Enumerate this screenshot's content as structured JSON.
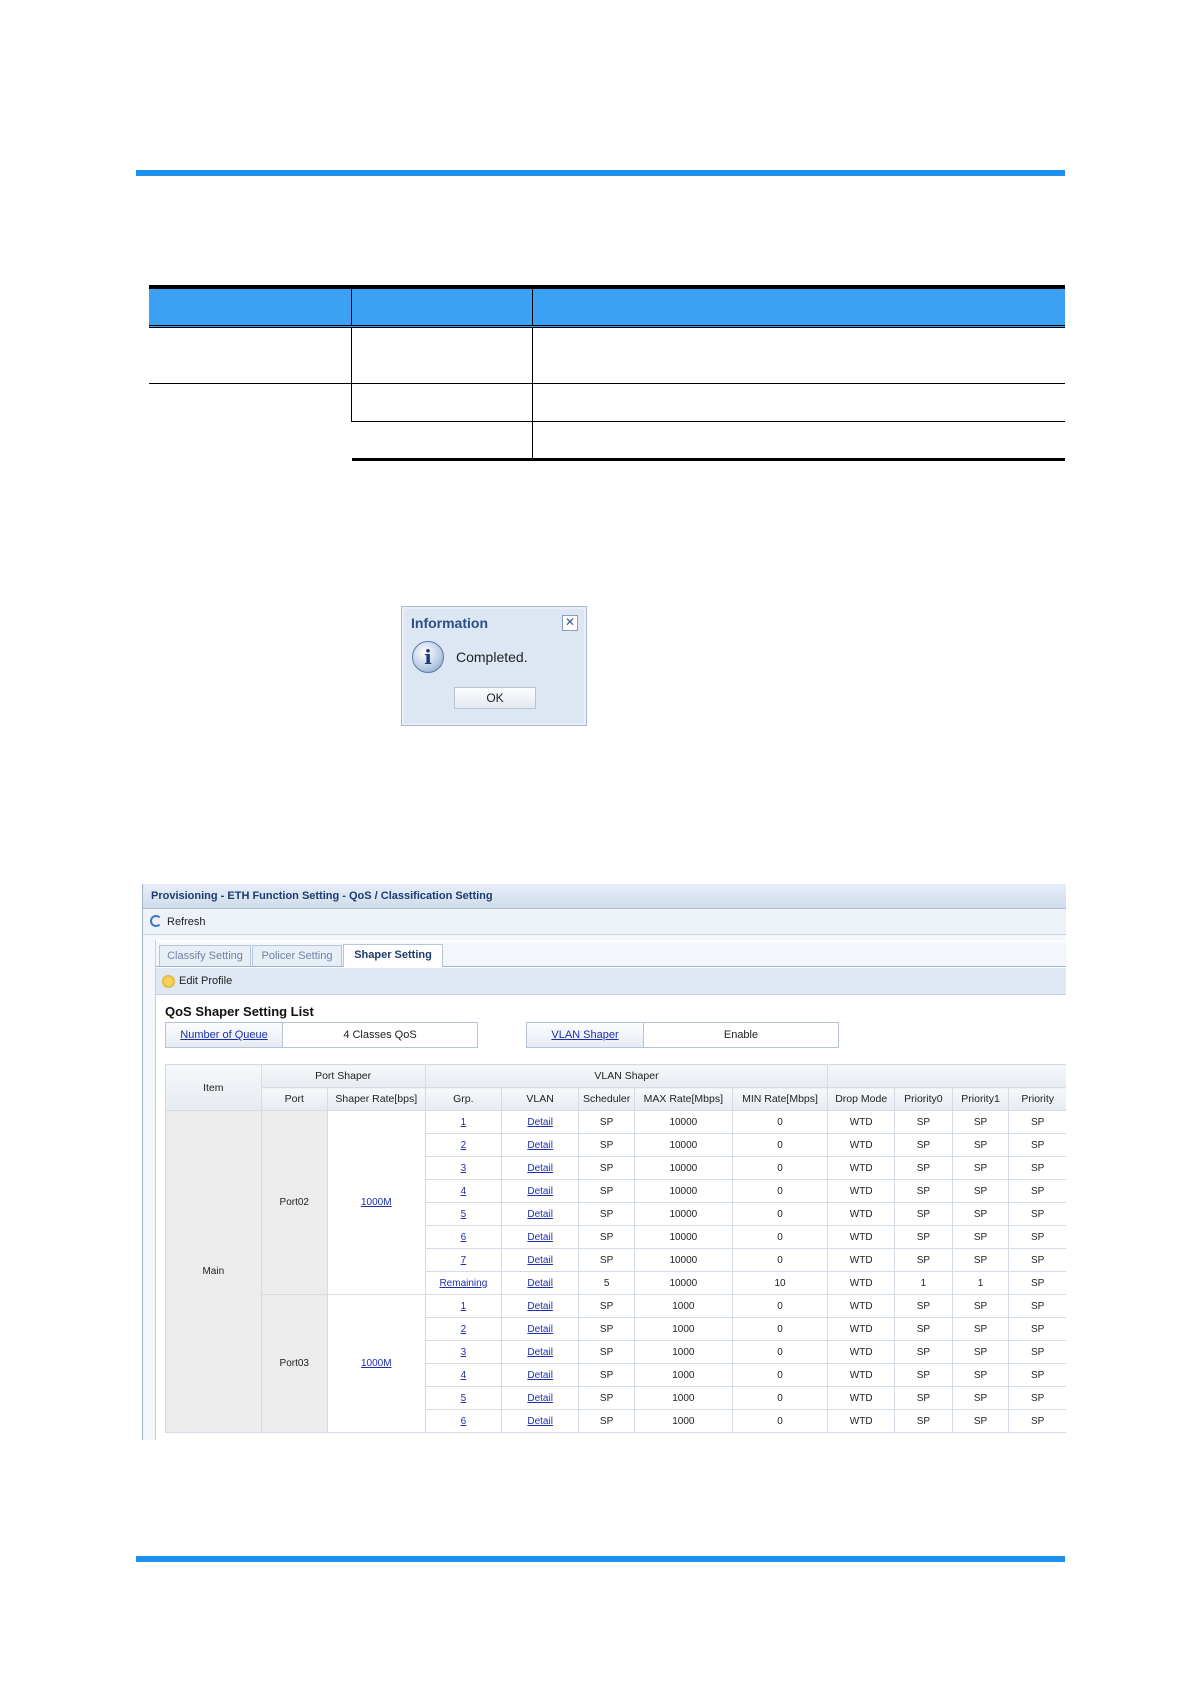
{
  "colors": {
    "rule": "#1e90ee",
    "table_header": "#3aa1f5",
    "link": "#1c2fb0",
    "app_title": "#1c3c6e"
  },
  "dialog": {
    "title": "Information",
    "message": "Completed.",
    "ok_label": "OK",
    "close_glyph": "✕",
    "info_glyph": "i"
  },
  "app": {
    "title": "Provisioning - ETH Function Setting - QoS / Classification Setting",
    "refresh_label": "Refresh",
    "tabs": [
      {
        "label": "Classify Setting"
      },
      {
        "label": "Policer Setting"
      },
      {
        "label": "Shaper Setting"
      }
    ],
    "edit_profile_label": "Edit Profile",
    "list_title": "QoS Shaper Setting List",
    "number_of_queue": {
      "label": "Number of Queue",
      "value": "4 Classes QoS"
    },
    "vlan_shaper": {
      "label": "VLAN Shaper",
      "value": "Enable"
    },
    "table": {
      "group_headers": {
        "item": "Item",
        "port_shaper": "Port Shaper",
        "vlan_shaper": "VLAN Shaper"
      },
      "headers": {
        "port": "Port",
        "shaper_rate": "Shaper Rate[bps]",
        "grp": "Grp.",
        "vlan": "VLAN",
        "scheduler": "Scheduler",
        "max_rate": "MAX Rate[Mbps]",
        "min_rate": "MIN Rate[Mbps]",
        "drop_mode": "Drop Mode",
        "priority0": "Priority0",
        "priority1": "Priority1",
        "priority2": "Priority"
      },
      "item": "Main",
      "ports": [
        {
          "port": "Port02",
          "rate": "1000M",
          "rows": [
            {
              "grp": "1",
              "vlan": "Detail",
              "scheduler": "SP",
              "max": "10000",
              "min": "0",
              "drop": "WTD",
              "p0": "SP",
              "p1": "SP",
              "p2": "SP"
            },
            {
              "grp": "2",
              "vlan": "Detail",
              "scheduler": "SP",
              "max": "10000",
              "min": "0",
              "drop": "WTD",
              "p0": "SP",
              "p1": "SP",
              "p2": "SP"
            },
            {
              "grp": "3",
              "vlan": "Detail",
              "scheduler": "SP",
              "max": "10000",
              "min": "0",
              "drop": "WTD",
              "p0": "SP",
              "p1": "SP",
              "p2": "SP"
            },
            {
              "grp": "4",
              "vlan": "Detail",
              "scheduler": "SP",
              "max": "10000",
              "min": "0",
              "drop": "WTD",
              "p0": "SP",
              "p1": "SP",
              "p2": "SP"
            },
            {
              "grp": "5",
              "vlan": "Detail",
              "scheduler": "SP",
              "max": "10000",
              "min": "0",
              "drop": "WTD",
              "p0": "SP",
              "p1": "SP",
              "p2": "SP"
            },
            {
              "grp": "6",
              "vlan": "Detail",
              "scheduler": "SP",
              "max": "10000",
              "min": "0",
              "drop": "WTD",
              "p0": "SP",
              "p1": "SP",
              "p2": "SP"
            },
            {
              "grp": "7",
              "vlan": "Detail",
              "scheduler": "SP",
              "max": "10000",
              "min": "0",
              "drop": "WTD",
              "p0": "SP",
              "p1": "SP",
              "p2": "SP"
            },
            {
              "grp": "Remaining",
              "vlan": "Detail",
              "scheduler": "5",
              "max": "10000",
              "min": "10",
              "drop": "WTD",
              "p0": "1",
              "p1": "1",
              "p2": "SP"
            }
          ]
        },
        {
          "port": "Port03",
          "rate": "1000M",
          "rows": [
            {
              "grp": "1",
              "vlan": "Detail",
              "scheduler": "SP",
              "max": "1000",
              "min": "0",
              "drop": "WTD",
              "p0": "SP",
              "p1": "SP",
              "p2": "SP"
            },
            {
              "grp": "2",
              "vlan": "Detail",
              "scheduler": "SP",
              "max": "1000",
              "min": "0",
              "drop": "WTD",
              "p0": "SP",
              "p1": "SP",
              "p2": "SP"
            },
            {
              "grp": "3",
              "vlan": "Detail",
              "scheduler": "SP",
              "max": "1000",
              "min": "0",
              "drop": "WTD",
              "p0": "SP",
              "p1": "SP",
              "p2": "SP"
            },
            {
              "grp": "4",
              "vlan": "Detail",
              "scheduler": "SP",
              "max": "1000",
              "min": "0",
              "drop": "WTD",
              "p0": "SP",
              "p1": "SP",
              "p2": "SP"
            },
            {
              "grp": "5",
              "vlan": "Detail",
              "scheduler": "SP",
              "max": "1000",
              "min": "0",
              "drop": "WTD",
              "p0": "SP",
              "p1": "SP",
              "p2": "SP"
            },
            {
              "grp": "6",
              "vlan": "Detail",
              "scheduler": "SP",
              "max": "1000",
              "min": "0",
              "drop": "WTD",
              "p0": "SP",
              "p1": "SP",
              "p2": "SP"
            }
          ]
        }
      ]
    }
  }
}
